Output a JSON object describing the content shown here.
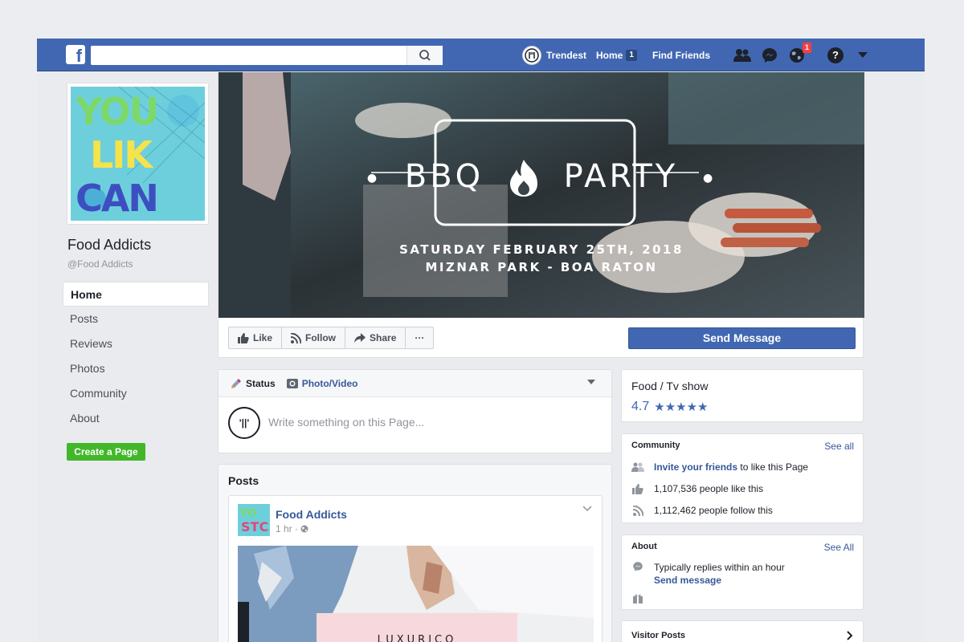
{
  "topbar": {
    "search": {
      "placeholder": ""
    },
    "user_name": "Trendest",
    "home_label": "Home",
    "home_count": "1",
    "find_friends": "Find Friends",
    "notifications_count": "1",
    "help_glyph": "?"
  },
  "sidebar": {
    "page_name": "Food Addicts",
    "page_handle": "@Food Addicts",
    "items": [
      {
        "label": "Home"
      },
      {
        "label": "Posts"
      },
      {
        "label": "Reviews"
      },
      {
        "label": "Photos"
      },
      {
        "label": "Community"
      },
      {
        "label": "About"
      }
    ],
    "create_page": "Create a Page",
    "profile_text": [
      "YOU",
      "LIK",
      "CAN"
    ]
  },
  "cover": {
    "title_left": "BBQ",
    "title_right": "PARTY",
    "line1": "SATURDAY FEBRUARY 25TH, 2018",
    "line2": "MIZNAR PARK - BOA RATON"
  },
  "actions": {
    "like": "Like",
    "follow": "Follow",
    "share": "Share",
    "more": "···",
    "send_message": "Send Message"
  },
  "composer": {
    "status_tab": "Status",
    "photo_tab": "Photo/Video",
    "avatar_text": "'||'",
    "placeholder": "Write something on this Page..."
  },
  "posts": {
    "title": "Posts",
    "post": {
      "author": "Food Addicts",
      "time": "1 hr ·",
      "image_text": "LUXURICO"
    }
  },
  "right": {
    "category": "Food / Tv show",
    "rating": "4.7",
    "stars": "★★★★★",
    "community": {
      "title": "Community",
      "see_all": "See all",
      "invite_link": "Invite your friends",
      "invite_rest": " to like this Page",
      "likes": "1,107,536 people like this",
      "follows": "1,112,462 people follow this"
    },
    "about": {
      "title": "About",
      "see_all": "See All",
      "replies": "Typically replies within an hour",
      "send_message": "Send message"
    },
    "visitor_posts": "Visitor Posts"
  },
  "colors": {
    "brand": "#4267b2",
    "link": "#365899",
    "create_green": "#42b72a",
    "notification_red": "#fa3e3e"
  },
  "icons": [
    "facebook-logo-icon",
    "search-icon",
    "friends-icon",
    "messenger-icon",
    "globe-icon",
    "help-icon",
    "dropdown-icon",
    "thumbs-up-icon",
    "rss-icon",
    "share-arrow-icon",
    "pencil-icon",
    "camera-icon",
    "chevron-down-icon",
    "globe-small-icon",
    "people-icon",
    "messenger-small-icon",
    "gift-icon",
    "chevron-right-icon"
  ]
}
